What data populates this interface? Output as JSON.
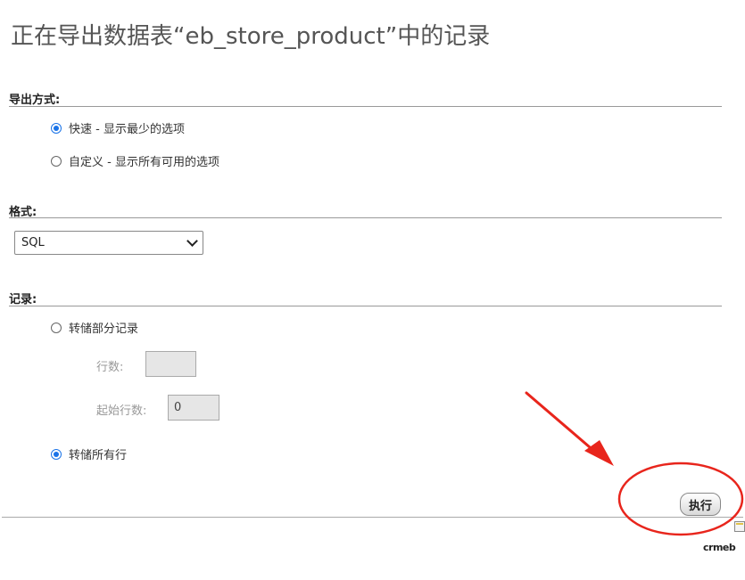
{
  "header": {
    "title": "正在导出数据表“eb_store_product”中的记录"
  },
  "export_method": {
    "legend": "导出方式:",
    "options": [
      {
        "label": "快速 - 显示最少的选项",
        "checked": true
      },
      {
        "label": "自定义 - 显示所有可用的选项",
        "checked": false
      }
    ]
  },
  "format": {
    "legend": "格式:",
    "selected": "SQL"
  },
  "records": {
    "legend": "记录:",
    "dump_partial_label": "转储部分记录",
    "dump_partial_checked": false,
    "row_count_label": "行数:",
    "row_count_value": "",
    "start_row_label": "起始行数:",
    "start_row_value": "0",
    "dump_all_label": "转储所有行",
    "dump_all_checked": true
  },
  "actions": {
    "execute_label": "执行"
  },
  "watermark": {
    "text": "crmeb"
  },
  "colors": {
    "radio_checked": "#1a73e8",
    "annotation_red": "#e8251c"
  }
}
